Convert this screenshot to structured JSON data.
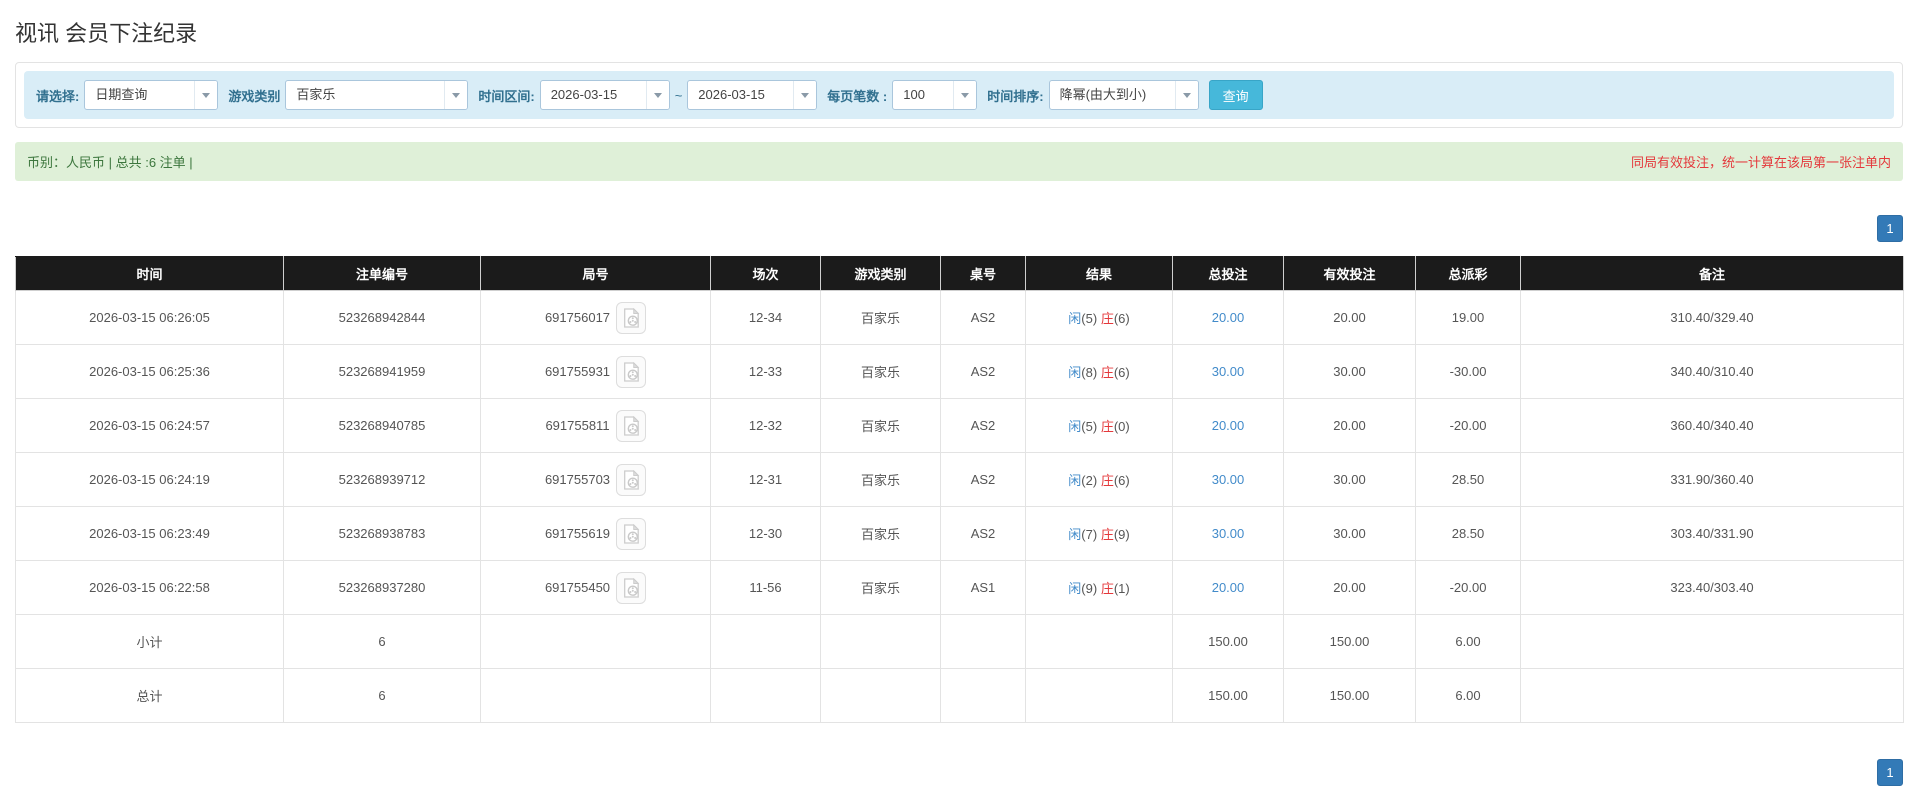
{
  "page": {
    "title": "视讯 会员下注纪录"
  },
  "filters": {
    "select_label": "请选择:",
    "select_value": "日期查询",
    "game_type_label": "游戏类别",
    "game_type_value": "百家乐",
    "time_range_label": "时间区间:",
    "date_from": "2026-03-15",
    "tilde": "~",
    "date_to": "2026-03-15",
    "page_size_label": "每页笔数 :",
    "page_size_value": "100",
    "sort_label": "时间排序:",
    "sort_value": "降幂(由大到小)",
    "search_button": "查询"
  },
  "summary": {
    "left": "币别：人民币 | 总共 :6 注单 |",
    "right_notice": "同局有效投注，统一计算在该局第一张注单内"
  },
  "pagination": {
    "page": "1"
  },
  "icons": {
    "dropdown_arrow": "caret-down",
    "round_video_icon": "video-record-document"
  },
  "colors": {
    "filter_bar_bg": "#d9edf7",
    "filter_label": "#31708f",
    "search_button": "#46b8da",
    "summary_bg": "#dff0d8",
    "summary_text": "#3c763d",
    "notice_red": "#e4393c",
    "link_blue": "#428bca",
    "table_header_bg": "#1b1b1b",
    "subtotal_bg": "#9d9d9d",
    "pager_blue": "#337ab7"
  },
  "table": {
    "headers": [
      "时间",
      "注单编号",
      "局号",
      "场次",
      "游戏类别",
      "桌号",
      "结果",
      "总投注",
      "有效投注",
      "总派彩",
      "备注"
    ],
    "result_labels": {
      "player": "闲",
      "banker": "庄"
    },
    "rows": [
      {
        "time": "2026-03-15 06:26:05",
        "bet_no": "523268942844",
        "round_no": "691756017",
        "session": "12-34",
        "game": "百家乐",
        "table_no": "AS2",
        "result_player": "(5)",
        "result_banker": "(6)",
        "total_bet": "20.00",
        "valid_bet": "20.00",
        "payout": "19.00",
        "payout_negative": false,
        "remark": "310.40/329.40"
      },
      {
        "time": "2026-03-15 06:25:36",
        "bet_no": "523268941959",
        "round_no": "691755931",
        "session": "12-33",
        "game": "百家乐",
        "table_no": "AS2",
        "result_player": "(8)",
        "result_banker": "(6)",
        "total_bet": "30.00",
        "valid_bet": "30.00",
        "payout": "-30.00",
        "payout_negative": true,
        "remark": "340.40/310.40"
      },
      {
        "time": "2026-03-15 06:24:57",
        "bet_no": "523268940785",
        "round_no": "691755811",
        "session": "12-32",
        "game": "百家乐",
        "table_no": "AS2",
        "result_player": "(5)",
        "result_banker": "(0)",
        "total_bet": "20.00",
        "valid_bet": "20.00",
        "payout": "-20.00",
        "payout_negative": true,
        "remark": "360.40/340.40"
      },
      {
        "time": "2026-03-15 06:24:19",
        "bet_no": "523268939712",
        "round_no": "691755703",
        "session": "12-31",
        "game": "百家乐",
        "table_no": "AS2",
        "result_player": "(2)",
        "result_banker": "(6)",
        "total_bet": "30.00",
        "valid_bet": "30.00",
        "payout": "28.50",
        "payout_negative": false,
        "remark": "331.90/360.40"
      },
      {
        "time": "2026-03-15 06:23:49",
        "bet_no": "523268938783",
        "round_no": "691755619",
        "session": "12-30",
        "game": "百家乐",
        "table_no": "AS2",
        "result_player": "(7)",
        "result_banker": "(9)",
        "total_bet": "30.00",
        "valid_bet": "30.00",
        "payout": "28.50",
        "payout_negative": false,
        "remark": "303.40/331.90"
      },
      {
        "time": "2026-03-15 06:22:58",
        "bet_no": "523268937280",
        "round_no": "691755450",
        "session": "11-56",
        "game": "百家乐",
        "table_no": "AS1",
        "result_player": "(9)",
        "result_banker": "(1)",
        "total_bet": "20.00",
        "valid_bet": "20.00",
        "payout": "-20.00",
        "payout_negative": true,
        "remark": "323.40/303.40"
      }
    ],
    "subtotal": {
      "label": "小计",
      "count": "6",
      "total_bet": "150.00",
      "valid_bet": "150.00",
      "payout": "6.00"
    },
    "total": {
      "label": "总计",
      "count": "6",
      "total_bet": "150.00",
      "valid_bet": "150.00",
      "payout": "6.00"
    }
  }
}
